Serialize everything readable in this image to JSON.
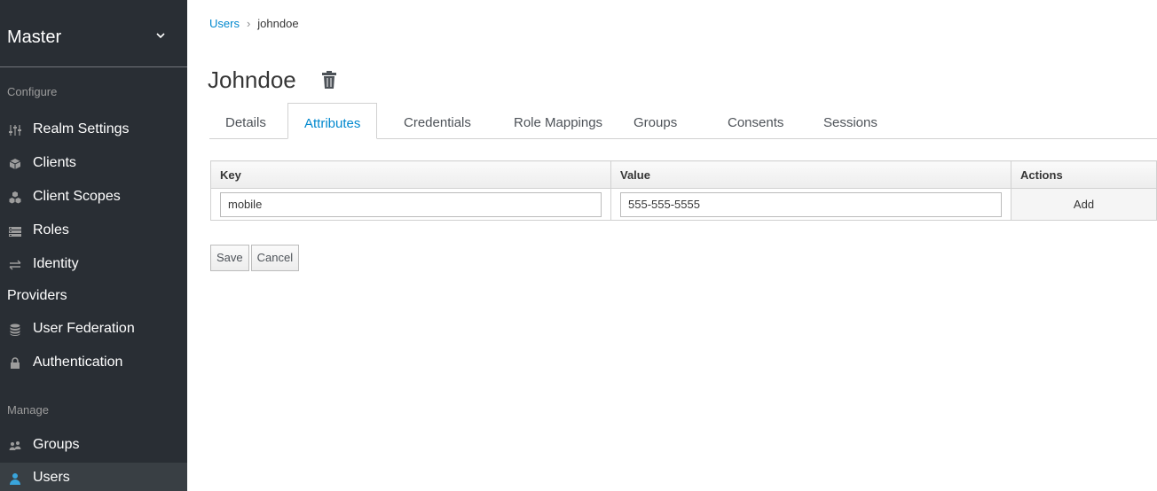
{
  "sidebar": {
    "realm": "Master",
    "configure_label": "Configure",
    "manage_label": "Manage",
    "configure_items": [
      {
        "label": "Realm Settings",
        "icon": "sliders-icon"
      },
      {
        "label": "Clients",
        "icon": "cube-icon"
      },
      {
        "label": "Client Scopes",
        "icon": "cubes-icon"
      },
      {
        "label": "Roles",
        "icon": "list-icon"
      },
      {
        "label": "Identity",
        "label2": "Providers",
        "icon": "exchange-icon"
      },
      {
        "label": "User Federation",
        "icon": "database-icon"
      },
      {
        "label": "Authentication",
        "icon": "lock-icon"
      }
    ],
    "manage_items": [
      {
        "label": "Groups",
        "icon": "users-icon"
      },
      {
        "label": "Users",
        "icon": "user-icon",
        "active": true
      }
    ]
  },
  "breadcrumb": {
    "parent": "Users",
    "current": "johndoe"
  },
  "page_title": "Johndoe",
  "tabs": [
    "Details",
    "Attributes",
    "Credentials",
    "Role Mappings",
    "Groups",
    "Consents",
    "Sessions"
  ],
  "active_tab": "Attributes",
  "table": {
    "headers": [
      "Key",
      "Value",
      "Actions"
    ],
    "row": {
      "key": "mobile",
      "value": "555-555-5555",
      "action": "Add"
    }
  },
  "buttons": {
    "save": "Save",
    "cancel": "Cancel"
  },
  "colors": {
    "sidebar_bg": "#292e34",
    "link": "#0088ce",
    "active_icon": "#39a5dc"
  }
}
